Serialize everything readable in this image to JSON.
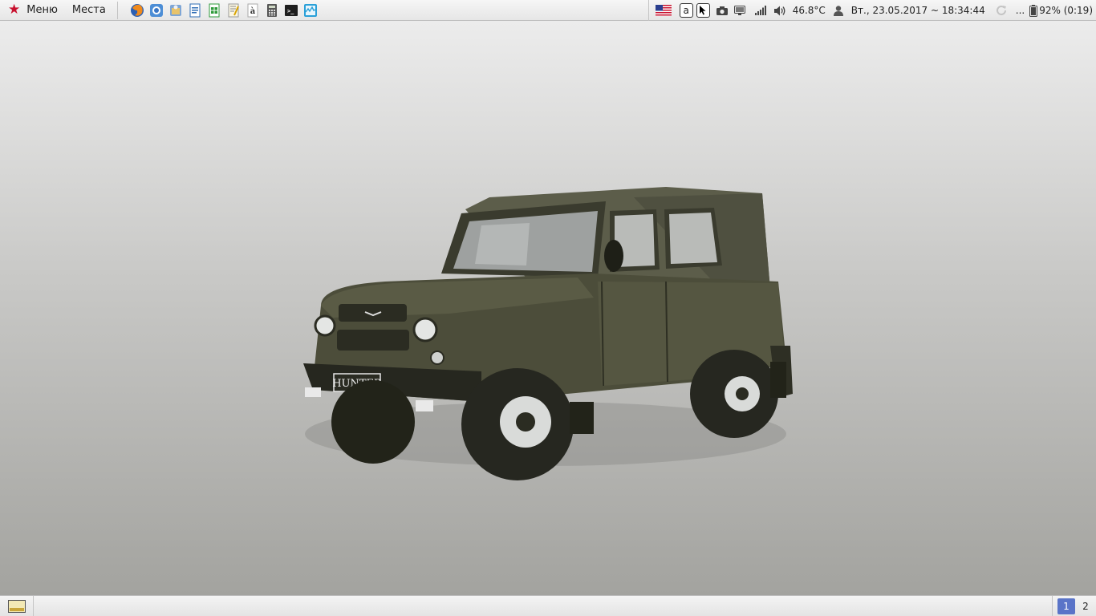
{
  "top_panel": {
    "menu_label": "Меню",
    "places_label": "Места",
    "launchers": [
      {
        "icon": "firefox-icon"
      },
      {
        "icon": "chromium-icon"
      },
      {
        "icon": "file-manager-icon"
      },
      {
        "icon": "writer-icon"
      },
      {
        "icon": "calc-spreadsheet-icon"
      },
      {
        "icon": "text-editor-icon"
      },
      {
        "icon": "font-viewer-icon",
        "glyph": "à"
      },
      {
        "icon": "calculator-icon"
      },
      {
        "icon": "terminal-icon",
        "glyph": ">_"
      },
      {
        "icon": "system-monitor-icon"
      }
    ],
    "tray": {
      "keyboard_a": "a",
      "temperature": "46.8°C",
      "datetime": "Вт., 23.05.2017 ~ 18:34:44",
      "ellipsis": "...",
      "battery": "92% (0:19)"
    }
  },
  "bottom_panel": {
    "workspaces": [
      "1",
      "2"
    ],
    "active_workspace": "1"
  },
  "wallpaper": {
    "plate_text": "HUNTER",
    "colors": {
      "body": "#4c4d3a",
      "top_bg": "#ececec",
      "bottom_bg": "#a3a39f"
    }
  }
}
